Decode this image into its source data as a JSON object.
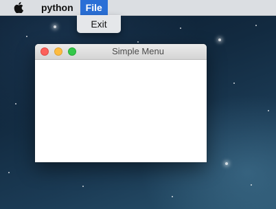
{
  "menubar": {
    "apple_icon": "apple-logo",
    "app_name": "python",
    "file_menu": "File"
  },
  "file_menu": {
    "items": [
      {
        "label": "Exit"
      }
    ]
  },
  "window": {
    "title": "Simple Menu",
    "buttons": [
      "close",
      "minimize",
      "zoom"
    ]
  },
  "colors": {
    "menu_highlight": "#2a6fd6",
    "close": "#fc605b",
    "minimize": "#fdbc40",
    "zoom": "#34c84a"
  }
}
